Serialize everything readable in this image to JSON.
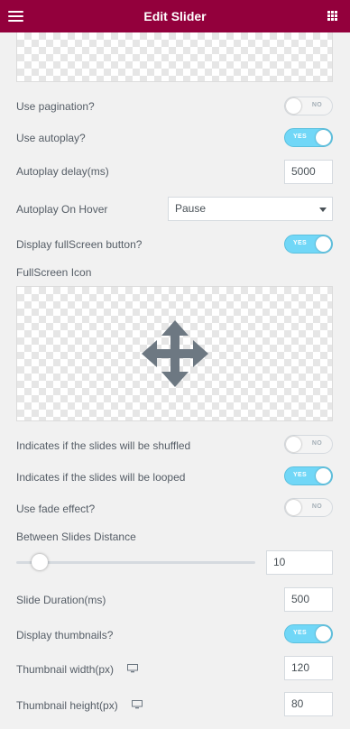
{
  "header": {
    "title": "Edit Slider"
  },
  "controls": {
    "use_pagination": {
      "label": "Use pagination?",
      "state": "NO"
    },
    "use_autoplay": {
      "label": "Use autoplay?",
      "state": "YES"
    },
    "autoplay_delay": {
      "label": "Autoplay delay(ms)",
      "value": "5000"
    },
    "autoplay_on_hover": {
      "label": "Autoplay On Hover",
      "value": "Pause"
    },
    "display_fullscreen": {
      "label": "Display fullScreen button?",
      "state": "YES"
    },
    "fullscreen_icon": {
      "label": "FullScreen Icon",
      "icon": "arrows-move-icon"
    },
    "shuffled": {
      "label": "Indicates if the slides will be shuffled",
      "state": "NO"
    },
    "looped": {
      "label": "Indicates if the slides will be looped",
      "state": "YES"
    },
    "fade_effect": {
      "label": "Use fade effect?",
      "state": "NO"
    },
    "between_slides_distance": {
      "label": "Between Slides Distance",
      "value": "10"
    },
    "slide_duration": {
      "label": "Slide Duration(ms)",
      "value": "500"
    },
    "display_thumbnails": {
      "label": "Display thumbnails?",
      "state": "YES"
    },
    "thumbnail_width": {
      "label": "Thumbnail width(px)",
      "value": "120"
    },
    "thumbnail_height": {
      "label": "Thumbnail height(px)",
      "value": "80"
    }
  },
  "colors": {
    "header_bg": "#93003c",
    "switch_on": "#71d7f7",
    "icon_gray": "#6d7882"
  }
}
